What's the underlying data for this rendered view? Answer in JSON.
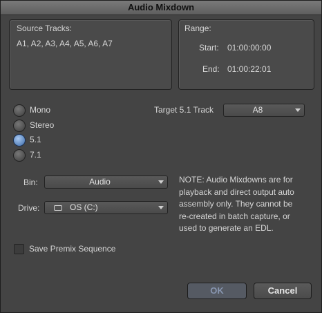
{
  "window": {
    "title": "Audio Mixdown"
  },
  "source": {
    "label": "Source Tracks:",
    "tracks": "A1, A2, A3, A4, A5, A6, A7"
  },
  "range": {
    "label": "Range:",
    "start_label": "Start:",
    "start_value": "01:00:00:00",
    "end_label": "End:",
    "end_value": "01:00:22:01"
  },
  "channels": {
    "options": [
      {
        "label": "Mono",
        "selected": false
      },
      {
        "label": "Stereo",
        "selected": false
      },
      {
        "label": "5.1",
        "selected": true
      },
      {
        "label": "7.1",
        "selected": false
      }
    ]
  },
  "target": {
    "label": "Target 5.1 Track",
    "value": "A8"
  },
  "bin": {
    "label": "Bin:",
    "value": "Audio"
  },
  "drive": {
    "label": "Drive:",
    "value": "OS (C:)"
  },
  "note": {
    "lines": [
      "NOTE: Audio Mixdowns are for",
      "playback and direct output auto",
      "assembly only.  They cannot be",
      "re-created in batch capture, or",
      "used to generate an EDL."
    ]
  },
  "premix": {
    "label": "Save Premix Sequence",
    "checked": false
  },
  "buttons": {
    "ok": "OK",
    "cancel": "Cancel"
  },
  "colors": {
    "selected_radio": "#3b6aa8",
    "dialog_bg": "#444444"
  }
}
